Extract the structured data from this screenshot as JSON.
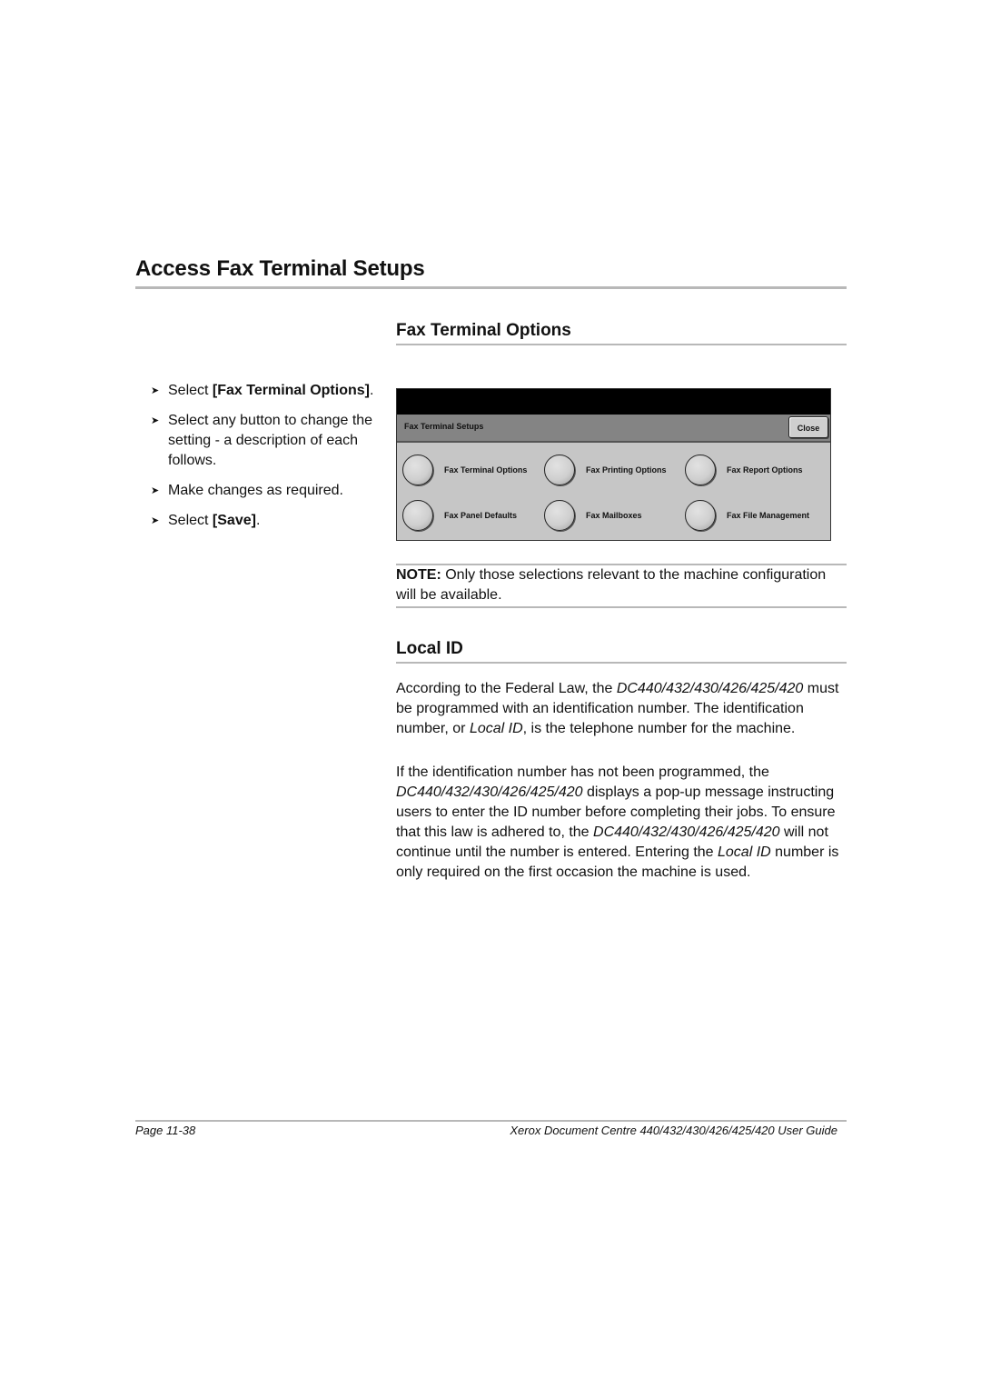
{
  "page": {
    "title": "Access Fax Terminal Setups",
    "section1": {
      "heading": "Fax Terminal Options",
      "steps": [
        {
          "prefix": "Select ",
          "bold": "[Fax Terminal Options]",
          "suffix": "."
        },
        {
          "text": "Select any button to change the setting - a description of each follows."
        },
        {
          "text": "Make changes as required."
        },
        {
          "prefix": "Select ",
          "bold": "[Save]",
          "suffix": "."
        }
      ],
      "bullet_icon": "arrowhead-bullet"
    },
    "screen": {
      "title": "Fax Terminal Setups",
      "close_label": "Close",
      "options": [
        {
          "label": "Fax Terminal Options"
        },
        {
          "label": "Fax Printing Options"
        },
        {
          "label": "Fax Report Options"
        },
        {
          "label": "Fax Panel Defaults"
        },
        {
          "label": "Fax Mailboxes"
        },
        {
          "label": "Fax File Management"
        }
      ]
    },
    "note": {
      "label": "NOTE:",
      "text": " Only those selections relevant to the machine configuration will be available."
    },
    "section2": {
      "heading": "Local ID",
      "para1": [
        {
          "t": "According to the Federal Law, the "
        },
        {
          "i": "DC440/432/430/426/425/420"
        },
        {
          "t": " must be programmed with an identification number. The identification number, or "
        },
        {
          "i": "Local ID"
        },
        {
          "t": ", is the telephone number for the machine."
        }
      ],
      "para2": [
        {
          "t": "If the identification number has not been programmed, the "
        },
        {
          "i": "DC440/432/430/426/425/420"
        },
        {
          "t": " displays a pop-up message instructing users to enter the ID number before completing their jobs. To ensure that this law is adhered to, the "
        },
        {
          "i": "DC440/432/430/426/425/420"
        },
        {
          "t": " will not continue until the number is entered. Entering the "
        },
        {
          "i": "Local ID"
        },
        {
          "t": " number is only required on the first occasion the machine is used."
        }
      ]
    },
    "footer": {
      "page": "Page 11-38",
      "guide": "Xerox Document Centre 440/432/430/426/425/420 User Guide"
    }
  }
}
